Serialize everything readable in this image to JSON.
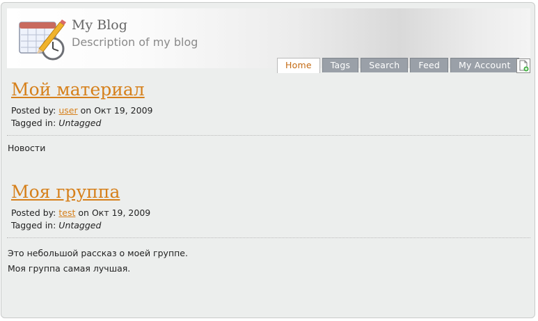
{
  "header": {
    "blog_title": "My Blog",
    "blog_description": "Description of my blog"
  },
  "nav": {
    "tabs": [
      {
        "label": "Home",
        "active": true
      },
      {
        "label": "Tags",
        "active": false
      },
      {
        "label": "Search",
        "active": false
      },
      {
        "label": "Feed",
        "active": false
      },
      {
        "label": "My Account",
        "active": false
      }
    ]
  },
  "posts": [
    {
      "title": "Мой материал",
      "posted_by_label": "Posted by:",
      "author": "user",
      "on_label": "on",
      "date": "Окт 19, 2009",
      "tagged_label": "Tagged in:",
      "tags": "Untagged",
      "body": [
        "Новости"
      ]
    },
    {
      "title": "Моя группа",
      "posted_by_label": "Posted by:",
      "author": "test",
      "on_label": "on",
      "date": "Окт 19, 2009",
      "tagged_label": "Tagged in:",
      "tags": "Untagged",
      "body": [
        "Это небольшой рассказ о моей группе.",
        "Моя группа самая лучшая."
      ]
    }
  ],
  "colors": {
    "accent": "#d6801b",
    "tab_inactive": "#9aa0a8",
    "background": "#eceeed"
  },
  "icons": {
    "logo": "calendar-clock-pencil-icon",
    "new_post": "new-document-icon"
  }
}
